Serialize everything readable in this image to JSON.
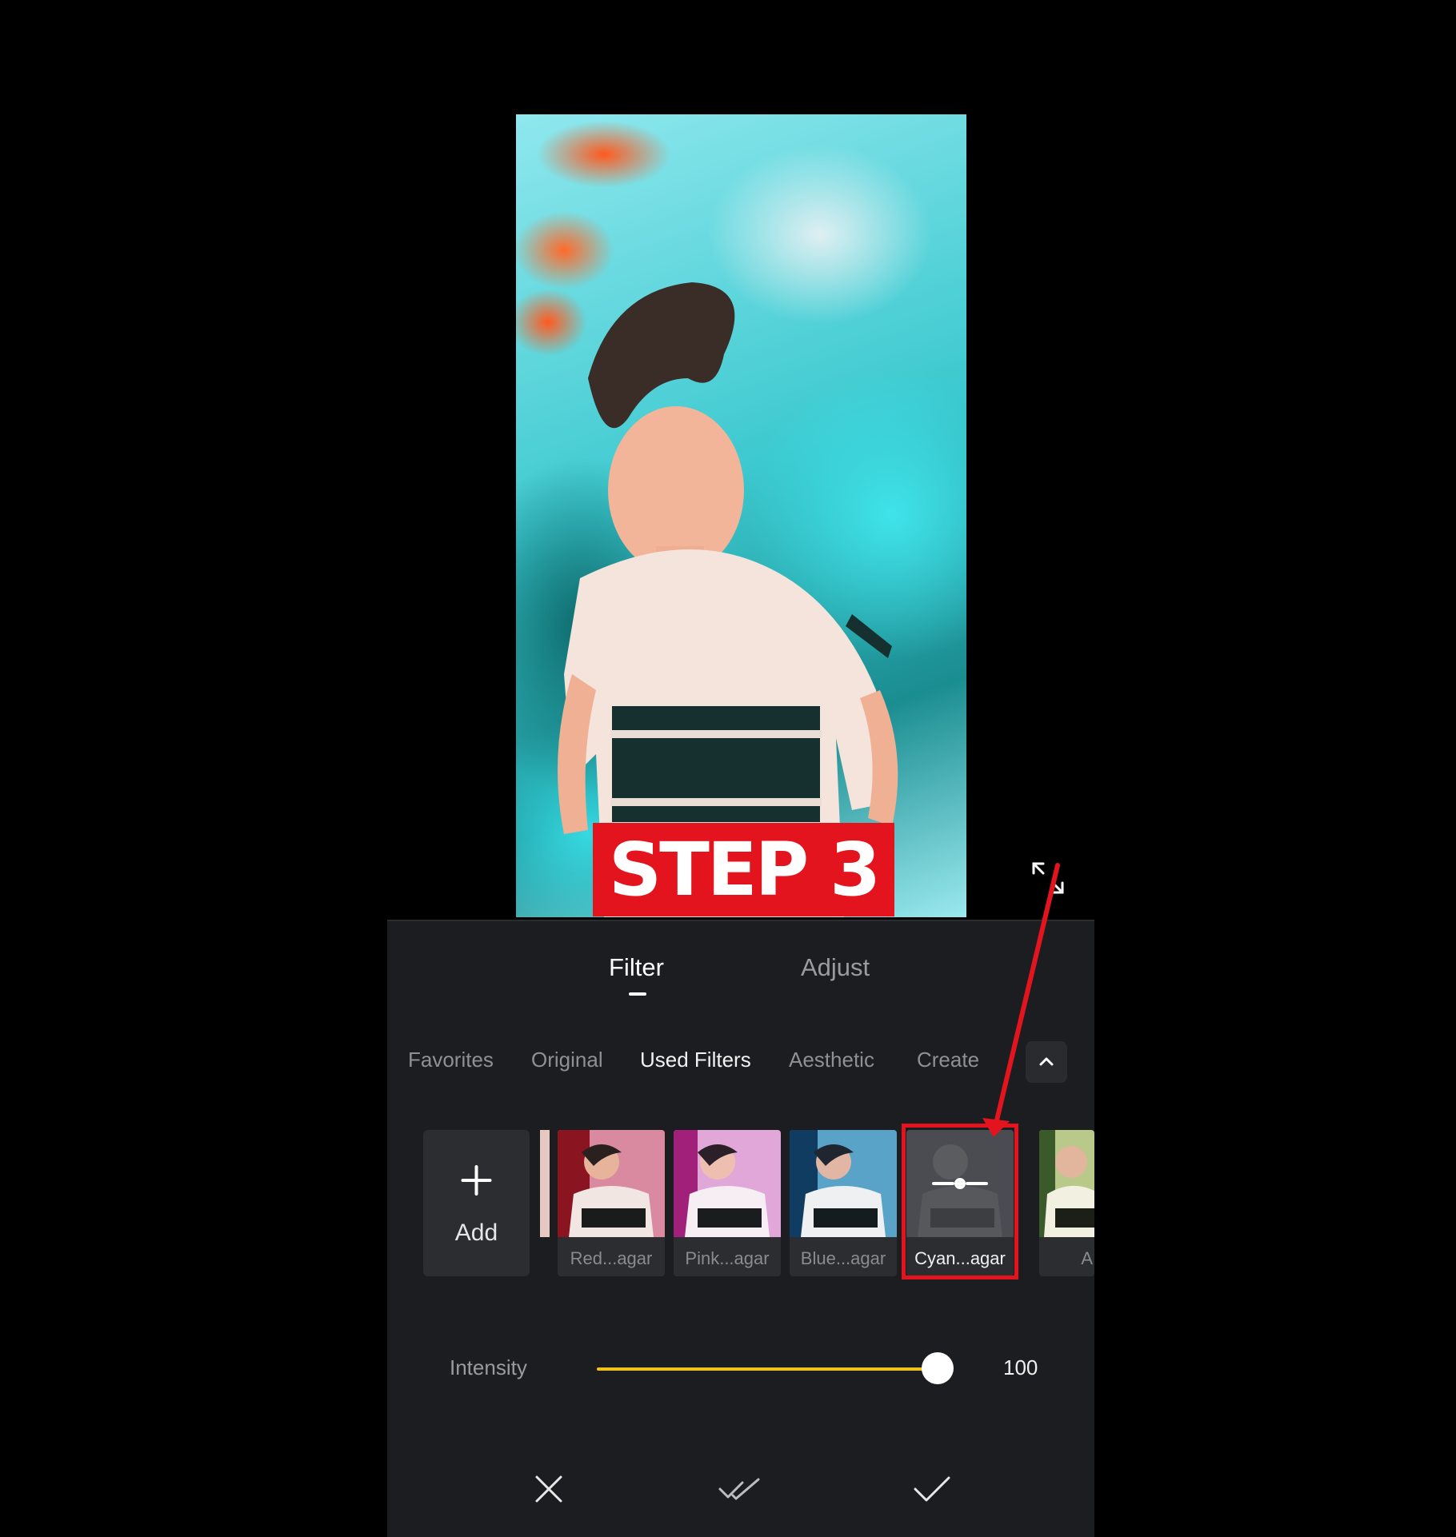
{
  "overlay": {
    "step_text": "STEP 3"
  },
  "panel": {
    "tabs": [
      {
        "label": "Filter",
        "active": true
      },
      {
        "label": "Adjust",
        "active": false
      }
    ],
    "categories": [
      {
        "label": "Favorites",
        "active": false
      },
      {
        "label": "Original",
        "active": false
      },
      {
        "label": "Used Filters",
        "active": true
      },
      {
        "label": "Aesthetic",
        "active": false
      },
      {
        "label": "Create",
        "active": false
      }
    ],
    "add_label": "Add",
    "filters": [
      {
        "label": "Red...agar",
        "selected": false
      },
      {
        "label": "Pink...agar",
        "selected": false
      },
      {
        "label": "Blue...agar",
        "selected": false
      },
      {
        "label": "Cyan...agar",
        "selected": true
      },
      {
        "label": "A",
        "selected": false
      }
    ],
    "intensity": {
      "label": "Intensity",
      "value": "100",
      "level": 1.0
    }
  },
  "colors": {
    "accent": "#f2c21b",
    "highlight": "#e3141e",
    "panel_bg": "#1c1d20"
  },
  "icons": [
    "expand-icon",
    "chevron-up-icon",
    "plus-icon",
    "adjust-slider-icon",
    "close-icon",
    "apply-all-icon",
    "check-icon"
  ]
}
